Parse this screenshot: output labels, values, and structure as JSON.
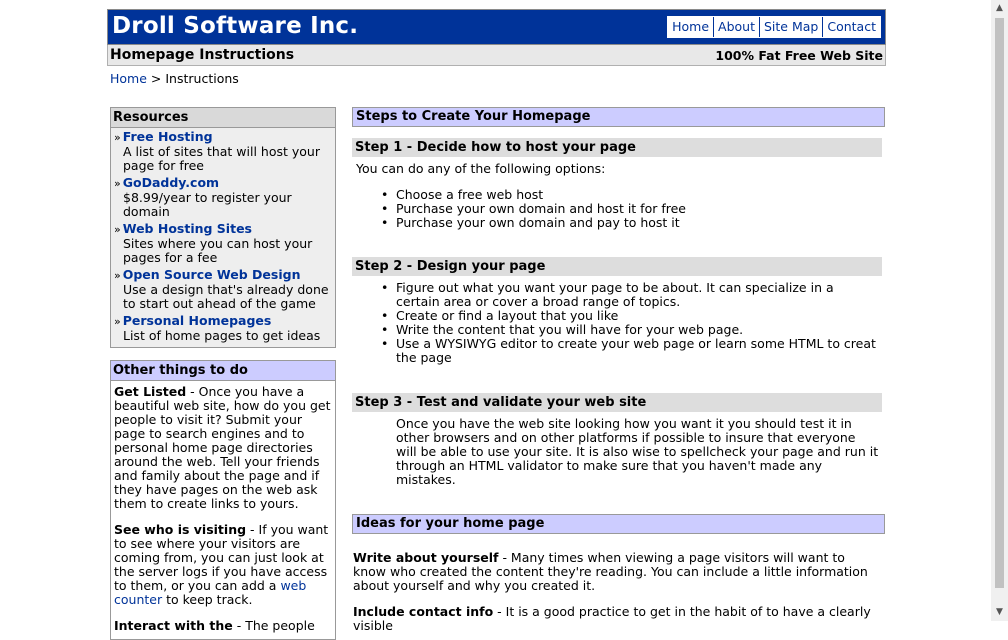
{
  "header": {
    "logo": "Droll Software Inc.",
    "nav": [
      "Home",
      "About",
      "Site Map",
      "Contact"
    ]
  },
  "subbar": {
    "title": "Homepage Instructions",
    "tagline": "100% Fat Free Web Site"
  },
  "breadcrumb": {
    "home": "Home",
    "sep": ">",
    "current": "Instructions"
  },
  "resources": {
    "title": "Resources",
    "items": [
      {
        "title": "Free Hosting",
        "desc": "A list of sites that will host your page for free"
      },
      {
        "title": "GoDaddy.com",
        "desc": "$8.99/year to register your domain"
      },
      {
        "title": "Web Hosting Sites",
        "desc": "Sites where you can host your pages for a fee"
      },
      {
        "title": "Open Source Web Design",
        "desc": "Use a design that's already done to start out ahead of the game"
      },
      {
        "title": "Personal Homepages",
        "desc": "List of home pages to get ideas"
      }
    ]
  },
  "other": {
    "title": "Other things to do",
    "p1_bold": "Get Listed",
    "p1_text": " - Once you have a beautiful web site, how do you get people to visit it? Submit your page to search engines and to personal home page directories around the web. Tell your friends and family about the page and if they have pages on the web ask them to create links to yours.",
    "p2_bold": "See who is visiting",
    "p2_text_a": " - If you want to see where your visitors are coming from, you can just look at the server logs if you have access to them, or you can add a ",
    "p2_link": "web counter",
    "p2_text_b": " to keep track.",
    "p3_bold": "Interact with the",
    "p3_text": " - The people"
  },
  "main": {
    "steps_title": "Steps to Create Your Homepage",
    "step1_title": "Step 1 - Decide how to host your page",
    "step1_intro": "You can do any of the following options:",
    "step1_items": [
      "Choose a free web host",
      "Purchase your own domain and host it for free",
      "Purchase your own domain and pay to host it"
    ],
    "step2_title": "Step 2 - Design your page",
    "step2_items": [
      "Figure out what you want your page to be about. It can specialize in a certain area or cover a broad range of topics.",
      "Create or find a layout that you like",
      "Write the content that you will have for your web page.",
      "Use a WYSIWYG editor to create your web page or learn some HTML to creat the page"
    ],
    "step3_title": "Step 3 - Test and validate your web site",
    "step3_text": "Once you have the web site looking how you want it you should test it in other browsers and on other platforms if possible to insure that everyone will be able to use your site. It is also wise to spellcheck your page and run it through an HTML validator to make sure that you haven't made any mistakes.",
    "ideas_title": "Ideas for your home page",
    "idea1_bold": "Write about yourself",
    "idea1_text": " - Many times when viewing a page visitors will want to know who created the content they're reading. You can include a little information about yourself and why you created it.",
    "idea2_bold": "Include contact info",
    "idea2_text": " - It is a good practice to get in the habit of to have a clearly visible"
  }
}
